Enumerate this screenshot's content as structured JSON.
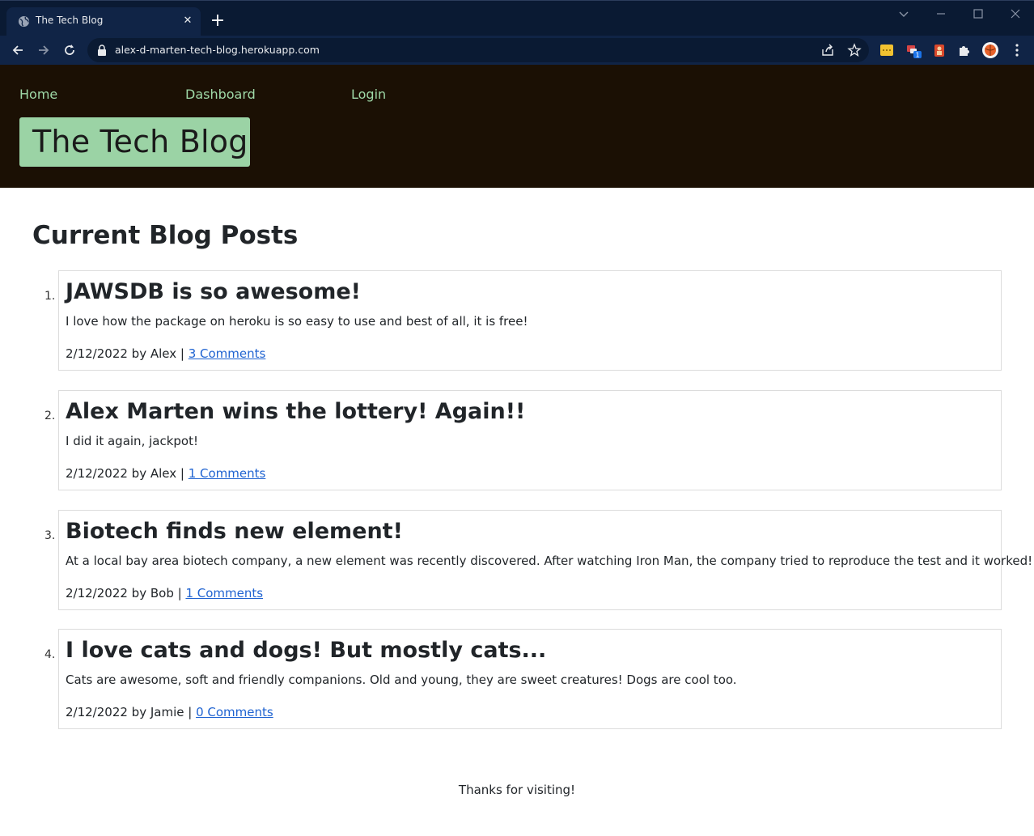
{
  "browser": {
    "tab_title": "The Tech Blog",
    "tab_close": "✕",
    "new_tab": "+",
    "url": "alex-d-marten-tech-blog.herokuapp.com",
    "extension_badge": "1"
  },
  "nav": {
    "home": "Home",
    "dashboard": "Dashboard",
    "login": "Login"
  },
  "site": {
    "brand": "The Tech Blog"
  },
  "main": {
    "heading": "Current Blog Posts",
    "posts": [
      {
        "number": "1.",
        "title": "JAWSDB is so awesome!",
        "body": "I love how the package on heroku is so easy to use and best of all, it is free!",
        "meta": "2/12/2022 by Alex | ",
        "comments": "3 Comments"
      },
      {
        "number": "2.",
        "title": "Alex Marten wins the lottery! Again!!",
        "body": "I did it again, jackpot!",
        "meta": "2/12/2022 by Alex | ",
        "comments": "1 Comments"
      },
      {
        "number": "3.",
        "title": "Biotech finds new element!",
        "body": "At a local bay area biotech company, a new element was recently discovered. After watching Iron Man, the company tried to reproduce the test and it worked!",
        "meta": "2/12/2022 by Bob | ",
        "comments": "1 Comments"
      },
      {
        "number": "4.",
        "title": "I love cats and dogs! But mostly cats...",
        "body": "Cats are awesome, soft and friendly companions. Old and young, they are sweet creatures! Dogs are cool too.",
        "meta": "2/12/2022 by Jamie | ",
        "comments": "0 Comments"
      }
    ]
  },
  "footer": {
    "text": "Thanks for visiting!"
  },
  "colors": {
    "header_bg": "#1b1004",
    "nav_link": "#9fd9a8",
    "brand_bg": "#9bd3a5",
    "link": "#1f63d1",
    "chrome_bg": "#0a1a33",
    "chrome_toolbar": "#102446"
  }
}
